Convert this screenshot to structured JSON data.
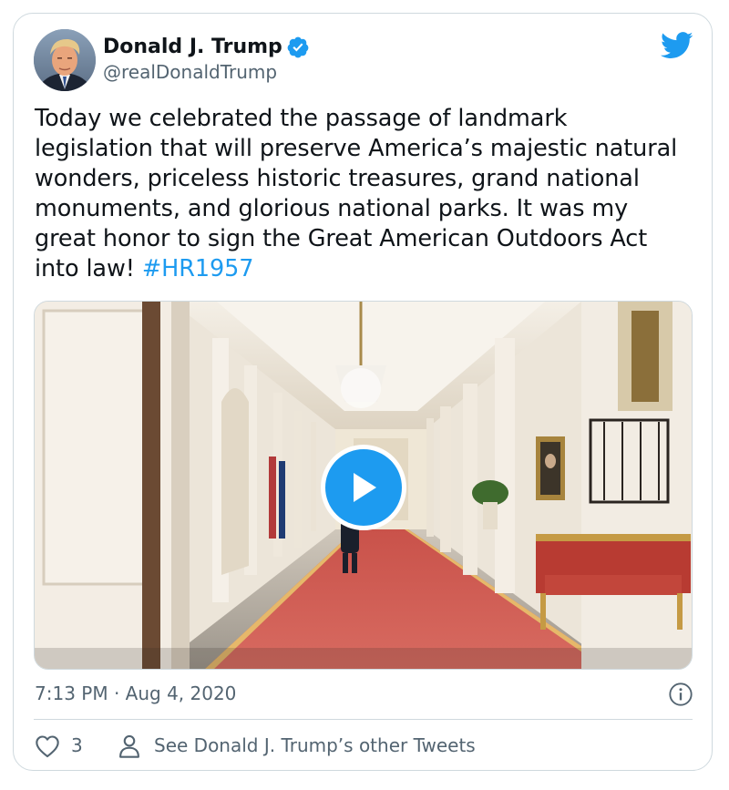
{
  "author": {
    "name": "Donald J. Trump",
    "handle": "@realDonaldTrump",
    "verified": true,
    "avatar_icon": "avatar-photo"
  },
  "brand": {
    "icon": "twitter-bird-icon",
    "color": "#1d9bf0"
  },
  "tweet": {
    "text": "Today we celebrated the passage of landmark legislation that will preserve America’s majestic natural wonders, priceless historic treasures, grand national monuments, and glorious national parks. It was my great honor to sign the Great American Outdoors Act into law! ",
    "hashtag": "#HR1957"
  },
  "media": {
    "type": "video",
    "scene": "White House Cross Hall with red carpet and chandelier",
    "play_icon": "play-icon"
  },
  "meta": {
    "timestamp": "7:13 PM · Aug 4, 2020",
    "info_icon": "info-icon"
  },
  "actions": {
    "like_count": "3",
    "other_tweets_label": "See Donald J. Trump’s other Tweets"
  },
  "colors": {
    "text": "#0f1419",
    "secondary": "#536471",
    "link": "#1d9bf0",
    "border": "#cfd9de"
  }
}
